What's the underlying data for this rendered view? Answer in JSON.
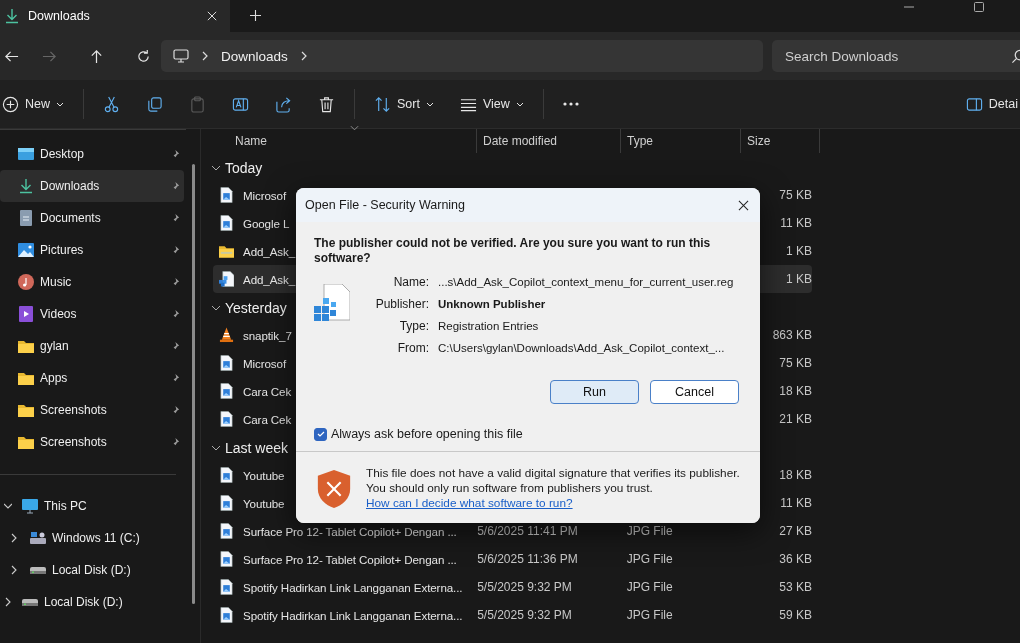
{
  "tab": {
    "title": "Downloads"
  },
  "nav_buttons": [
    {
      "kind": "back",
      "disabled": false
    },
    {
      "kind": "forward",
      "disabled": true
    },
    {
      "kind": "up",
      "disabled": false
    },
    {
      "kind": "refresh",
      "disabled": false
    }
  ],
  "address_bar": {
    "segments": [
      "Downloads"
    ]
  },
  "search": {
    "placeholder": "Search Downloads"
  },
  "toolbar": {
    "items": [
      {
        "kind": "new",
        "label": "New",
        "disabled": false
      },
      {
        "kind": "cut",
        "disabled": false
      },
      {
        "kind": "copy",
        "disabled": false
      },
      {
        "kind": "paste",
        "disabled": true
      },
      {
        "kind": "rename",
        "disabled": false
      },
      {
        "kind": "share",
        "disabled": false
      },
      {
        "kind": "delete",
        "disabled": false
      },
      {
        "kind": "sort",
        "label": "Sort",
        "disabled": false
      },
      {
        "kind": "view",
        "label": "View",
        "disabled": false
      },
      {
        "kind": "more",
        "disabled": false
      }
    ],
    "details_label": "Detai"
  },
  "columns": [
    "Name",
    "Date modified",
    "Type",
    "Size"
  ],
  "sidebar": {
    "pinned": [
      {
        "label": "Desktop",
        "kind": "desktop",
        "selected": false
      },
      {
        "label": "Downloads",
        "kind": "downloads",
        "selected": true
      },
      {
        "label": "Documents",
        "kind": "documents",
        "selected": false
      },
      {
        "label": "Pictures",
        "kind": "pictures",
        "selected": false
      },
      {
        "label": "Music",
        "kind": "music",
        "selected": false
      },
      {
        "label": "Videos",
        "kind": "videos",
        "selected": false
      },
      {
        "label": "gylan",
        "kind": "folder",
        "selected": false
      },
      {
        "label": "Apps",
        "kind": "folder",
        "selected": false
      },
      {
        "label": "Screenshots",
        "kind": "folder",
        "selected": false
      },
      {
        "label": "Screenshots",
        "kind": "folder",
        "selected": false
      }
    ],
    "drives": [
      {
        "label": "This PC",
        "kind": "pc",
        "expanded": true,
        "children": [
          {
            "label": "Windows 11 (C:)",
            "kind": "system-drive",
            "expanded": false
          },
          {
            "label": "Local Disk (D:)",
            "kind": "drive",
            "expanded": false
          }
        ]
      },
      {
        "label": "Local Disk (D:)",
        "kind": "drive",
        "expanded": false
      }
    ]
  },
  "groups": [
    {
      "label": "Today",
      "expanded": true,
      "rows": [
        {
          "name": "Microsof",
          "kind": "image",
          "selected": false,
          "size": "75 KB"
        },
        {
          "name": "Google L",
          "kind": "image",
          "selected": false,
          "size": "11 KB"
        },
        {
          "name": "Add_Ask_",
          "kind": "zip",
          "selected": false,
          "size": "1 KB"
        },
        {
          "name": "Add_Ask_",
          "kind": "reg",
          "selected": true,
          "size": "1 KB"
        }
      ]
    },
    {
      "label": "Yesterday",
      "expanded": true,
      "rows": [
        {
          "name": "snaptik_7",
          "kind": "video",
          "selected": false,
          "size": "863 KB"
        },
        {
          "name": "Microsof",
          "kind": "image",
          "selected": false,
          "size": "75 KB"
        },
        {
          "name": "Cara Cek",
          "kind": "image",
          "selected": false,
          "size": "18 KB"
        },
        {
          "name": "Cara Cek",
          "kind": "image",
          "selected": false,
          "size": "21 KB"
        }
      ]
    },
    {
      "label": "Last week",
      "expanded": true,
      "rows": [
        {
          "name": "Youtube",
          "kind": "image",
          "selected": false,
          "size": "18 KB"
        },
        {
          "name": "Youtube",
          "kind": "image",
          "selected": false,
          "size": "11 KB"
        },
        {
          "name": "Surface Pro 12- Tablet Copilot+ Dengan ...",
          "kind": "image",
          "selected": false,
          "date": "5/6/2025 11:41 PM",
          "type": "JPG File",
          "size": "27 KB"
        },
        {
          "name": "Surface Pro 12- Tablet Copilot+ Dengan ...",
          "kind": "image",
          "selected": false,
          "date": "5/6/2025 11:36 PM",
          "type": "JPG File",
          "size": "36 KB"
        },
        {
          "name": "Spotify Hadirkan Link Langganan Externa...",
          "kind": "image",
          "selected": false,
          "date": "5/5/2025 9:32 PM",
          "type": "JPG File",
          "size": "53 KB"
        },
        {
          "name": "Spotify Hadirkan Link Langganan Externa...",
          "kind": "image",
          "selected": false,
          "date": "5/5/2025 9:32 PM",
          "type": "JPG File",
          "size": "59 KB"
        }
      ]
    }
  ],
  "dialog": {
    "title": "Open File - Security Warning",
    "question": "The publisher could not be verified.  Are you sure you want to run this software?",
    "fields": [
      {
        "label": "Name:",
        "value": "...s\\Add_Ask_Copilot_context_menu_for_current_user.reg",
        "bold": false
      },
      {
        "label": "Publisher:",
        "value": "Unknown Publisher",
        "bold": true
      },
      {
        "label": "Type:",
        "value": "Registration Entries",
        "bold": false
      },
      {
        "label": "From:",
        "value": "C:\\Users\\gylan\\Downloads\\Add_Ask_Copilot_context_...",
        "bold": false
      }
    ],
    "buttons": [
      {
        "label": "Run",
        "default": true
      },
      {
        "label": "Cancel",
        "default": false
      }
    ],
    "checkbox": {
      "label": "Always ask before opening this file",
      "checked": true
    },
    "warning": {
      "text": "This file does not have a valid digital signature that verifies its publisher.  You should only run software from publishers you trust.",
      "link": "How can I decide what software to run?"
    }
  }
}
